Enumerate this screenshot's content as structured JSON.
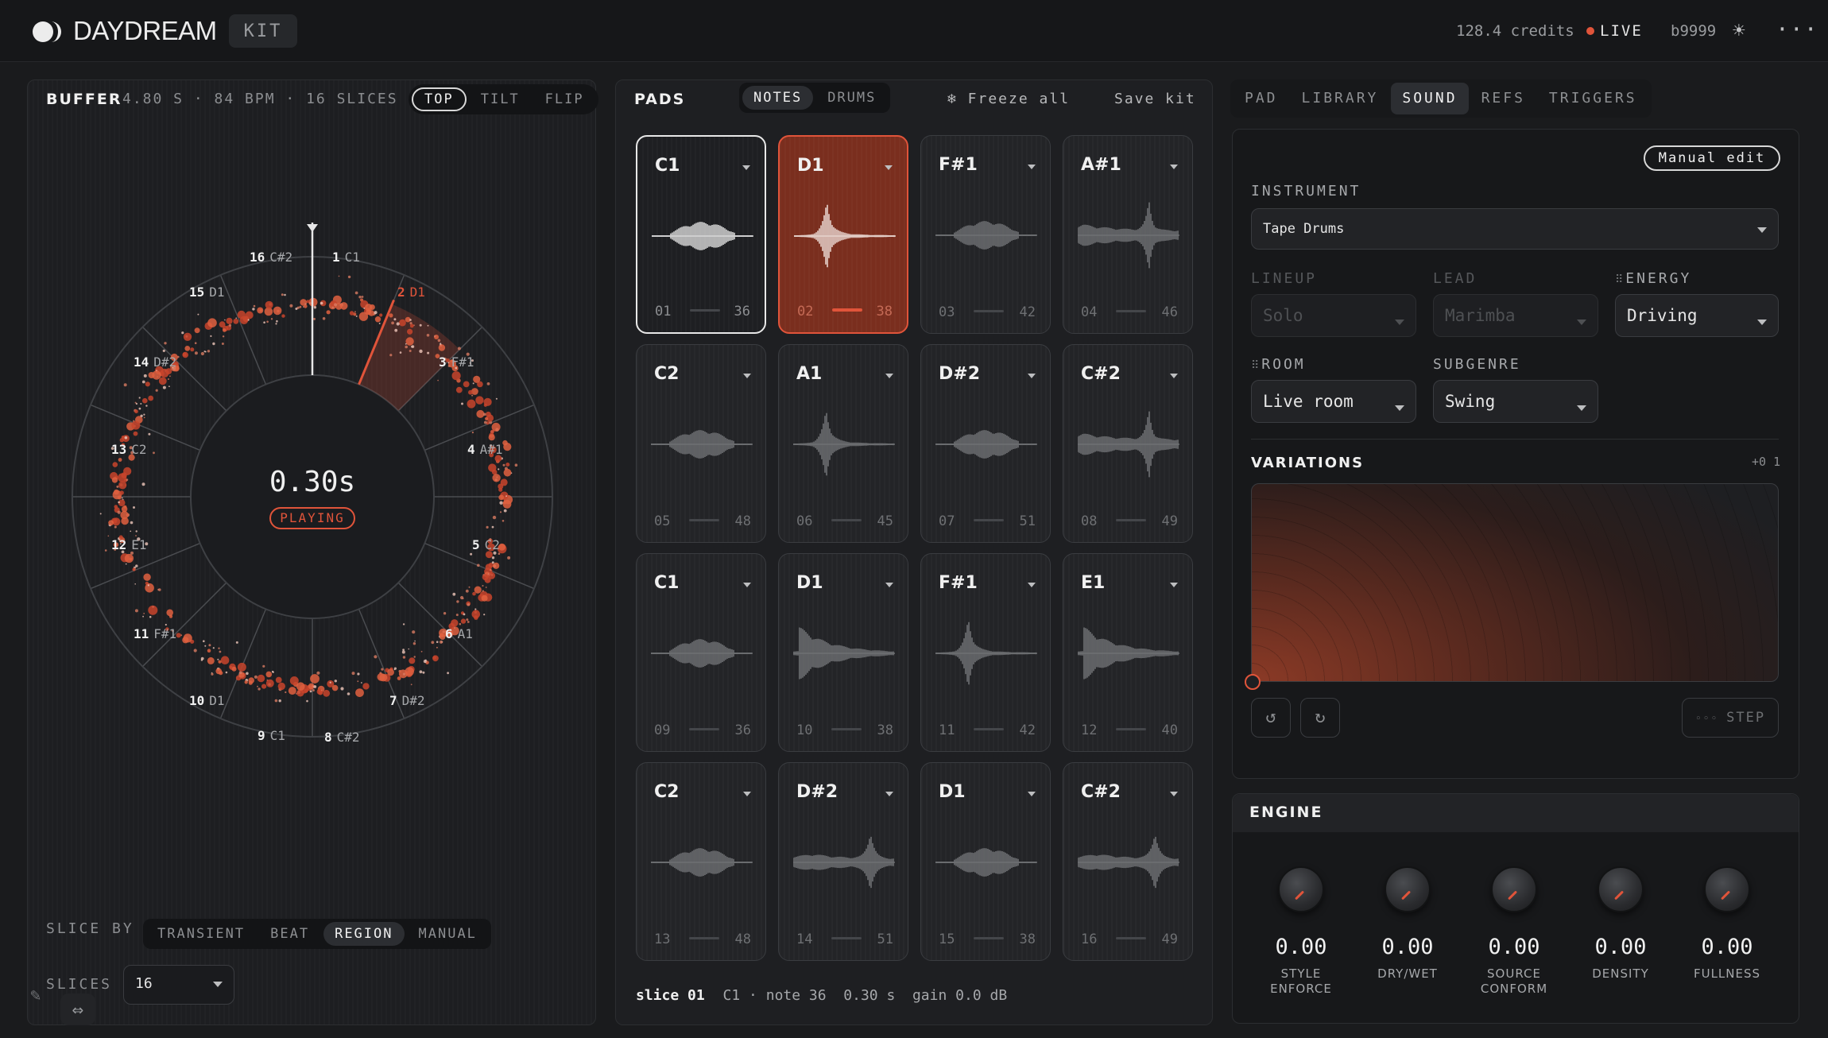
{
  "app": {
    "brand": "DAYDREAM",
    "mode": "KIT",
    "credits": "128.4 credits",
    "live": "LIVE",
    "user": "b9999",
    "icons": {
      "theme": "sun-icon",
      "more": "more-icon"
    }
  },
  "colors": {
    "accent": "#e0543a",
    "bg": "#1a1b1d"
  },
  "buffer": {
    "title": "BUFFER",
    "meta": "4.80 S · 84 BPM · 16 SLICES",
    "views": [
      "TOP",
      "TILT",
      "FLIP"
    ],
    "active_view": "TOP",
    "time": "0.30s",
    "status": "PLAYING",
    "slices": [
      {
        "n": "1",
        "note": "C1"
      },
      {
        "n": "2",
        "note": "D1"
      },
      {
        "n": "3",
        "note": "F#1"
      },
      {
        "n": "4",
        "note": "A#1"
      },
      {
        "n": "5",
        "note": "C2"
      },
      {
        "n": "6",
        "note": "A1"
      },
      {
        "n": "7",
        "note": "D#2"
      },
      {
        "n": "8",
        "note": "C#2"
      },
      {
        "n": "9",
        "note": "C1"
      },
      {
        "n": "10",
        "note": "D1"
      },
      {
        "n": "11",
        "note": "F#1"
      },
      {
        "n": "12",
        "note": "E1"
      },
      {
        "n": "13",
        "note": "C2"
      },
      {
        "n": "14",
        "note": "D#2"
      },
      {
        "n": "15",
        "note": "D1"
      },
      {
        "n": "16",
        "note": "C#2"
      }
    ],
    "active_slice": "2",
    "slice_by_label": "SLICE BY",
    "slice_by": [
      "TRANSIENT",
      "BEAT",
      "REGION",
      "MANUAL"
    ],
    "active_slice_by": "REGION",
    "slices_label": "SLICES",
    "slices_value": "16"
  },
  "pads": {
    "title": "PADS",
    "modes": [
      "NOTES",
      "DRUMS"
    ],
    "active_mode": "NOTES",
    "freeze": "❄ Freeze all",
    "save": "Save kit",
    "items": [
      {
        "note": "C1",
        "num": "01",
        "val": "36",
        "state": "selected"
      },
      {
        "note": "D1",
        "num": "02",
        "val": "38",
        "state": "playing"
      },
      {
        "note": "F#1",
        "num": "03",
        "val": "42",
        "state": ""
      },
      {
        "note": "A#1",
        "num": "04",
        "val": "46",
        "state": ""
      },
      {
        "note": "C2",
        "num": "05",
        "val": "48",
        "state": ""
      },
      {
        "note": "A1",
        "num": "06",
        "val": "45",
        "state": ""
      },
      {
        "note": "D#2",
        "num": "07",
        "val": "51",
        "state": ""
      },
      {
        "note": "C#2",
        "num": "08",
        "val": "49",
        "state": ""
      },
      {
        "note": "C1",
        "num": "09",
        "val": "36",
        "state": ""
      },
      {
        "note": "D1",
        "num": "10",
        "val": "38",
        "state": ""
      },
      {
        "note": "F#1",
        "num": "11",
        "val": "42",
        "state": ""
      },
      {
        "note": "E1",
        "num": "12",
        "val": "40",
        "state": ""
      },
      {
        "note": "C2",
        "num": "13",
        "val": "48",
        "state": ""
      },
      {
        "note": "D#2",
        "num": "14",
        "val": "51",
        "state": ""
      },
      {
        "note": "D1",
        "num": "15",
        "val": "38",
        "state": ""
      },
      {
        "note": "C#2",
        "num": "16",
        "val": "49",
        "state": ""
      }
    ],
    "footer": {
      "slice": "slice 01",
      "rest": "C1 · note 36  0.30 s  gain 0.0 dB"
    }
  },
  "sound": {
    "tabs": [
      "PAD",
      "LIBRARY",
      "SOUND",
      "REFS",
      "TRIGGERS"
    ],
    "active_tab": "SOUND",
    "manual_edit": "Manual edit",
    "instrument_label": "INSTRUMENT",
    "instrument": "Tape Drums",
    "lineup_label": "LINEUP",
    "lineup": "Solo",
    "lead_label": "LEAD",
    "lead": "Marimba",
    "energy_label": "ENERGY",
    "energy": "Driving",
    "room_label": "ROOM",
    "room": "Live room",
    "subgenre_label": "SUBGENRE",
    "subgenre": "Swing",
    "variations_label": "VARIATIONS",
    "variations_count": "+0 1",
    "step": "STEP"
  },
  "engine": {
    "title": "ENGINE",
    "knobs": [
      {
        "value": "0.00",
        "label1": "STYLE",
        "label2": "ENFORCE"
      },
      {
        "value": "0.00",
        "label1": "DRY/WET",
        "label2": ""
      },
      {
        "value": "0.00",
        "label1": "SOURCE",
        "label2": "CONFORM"
      },
      {
        "value": "0.00",
        "label1": "DENSITY",
        "label2": ""
      },
      {
        "value": "0.00",
        "label1": "FULLNESS",
        "label2": ""
      }
    ]
  }
}
